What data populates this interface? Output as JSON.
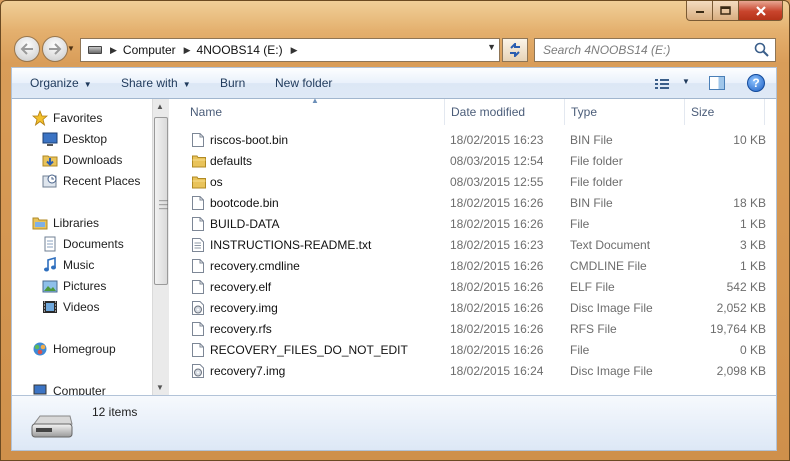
{
  "window": {
    "controls": {
      "minimize_icon": "minimize-icon",
      "maximize_icon": "maximize-icon",
      "close_icon": "close-icon"
    }
  },
  "address": {
    "crumbs": [
      "Computer",
      "4NOOBS14 (E:)"
    ]
  },
  "search": {
    "placeholder": "Search 4NOOBS14 (E:)"
  },
  "toolbar": {
    "organize": "Organize",
    "share_with": "Share with",
    "burn": "Burn",
    "new_folder": "New folder"
  },
  "sidebar": {
    "items": [
      {
        "label": "Favorites",
        "icon": "star-icon"
      },
      {
        "label": "Desktop",
        "icon": "desktop-icon"
      },
      {
        "label": "Downloads",
        "icon": "downloads-icon"
      },
      {
        "label": "Recent Places",
        "icon": "recent-places-icon"
      },
      {
        "label": "Libraries",
        "icon": "libraries-icon"
      },
      {
        "label": "Documents",
        "icon": "documents-icon"
      },
      {
        "label": "Music",
        "icon": "music-icon"
      },
      {
        "label": "Pictures",
        "icon": "pictures-icon"
      },
      {
        "label": "Videos",
        "icon": "videos-icon"
      },
      {
        "label": "Homegroup",
        "icon": "homegroup-icon"
      },
      {
        "label": "Computer",
        "icon": "computer-icon"
      }
    ]
  },
  "columns": {
    "name": "Name",
    "date": "Date modified",
    "type": "Type",
    "size": "Size"
  },
  "files": [
    {
      "name": "riscos-boot.bin",
      "date": "18/02/2015 16:23",
      "type": "BIN File",
      "size": "10 KB",
      "icon": "file-icon"
    },
    {
      "name": "defaults",
      "date": "08/03/2015 12:54",
      "type": "File folder",
      "size": "",
      "icon": "folder-icon"
    },
    {
      "name": "os",
      "date": "08/03/2015 12:55",
      "type": "File folder",
      "size": "",
      "icon": "folder-icon"
    },
    {
      "name": "bootcode.bin",
      "date": "18/02/2015 16:26",
      "type": "BIN File",
      "size": "18 KB",
      "icon": "file-icon"
    },
    {
      "name": "BUILD-DATA",
      "date": "18/02/2015 16:26",
      "type": "File",
      "size": "1 KB",
      "icon": "file-icon"
    },
    {
      "name": "INSTRUCTIONS-README.txt",
      "date": "18/02/2015 16:23",
      "type": "Text Document",
      "size": "3 KB",
      "icon": "text-file-icon"
    },
    {
      "name": "recovery.cmdline",
      "date": "18/02/2015 16:26",
      "type": "CMDLINE File",
      "size": "1 KB",
      "icon": "file-icon"
    },
    {
      "name": "recovery.elf",
      "date": "18/02/2015 16:26",
      "type": "ELF File",
      "size": "542 KB",
      "icon": "file-icon"
    },
    {
      "name": "recovery.img",
      "date": "18/02/2015 16:26",
      "type": "Disc Image File",
      "size": "2,052 KB",
      "icon": "disc-image-icon"
    },
    {
      "name": "recovery.rfs",
      "date": "18/02/2015 16:26",
      "type": "RFS File",
      "size": "19,764 KB",
      "icon": "file-icon"
    },
    {
      "name": "RECOVERY_FILES_DO_NOT_EDIT",
      "date": "18/02/2015 16:26",
      "type": "File",
      "size": "0 KB",
      "icon": "file-icon"
    },
    {
      "name": "recovery7.img",
      "date": "18/02/2015 16:24",
      "type": "Disc Image File",
      "size": "2,098 KB",
      "icon": "disc-image-icon"
    }
  ],
  "status": {
    "count": "12 items",
    "icon": "removable-drive-icon"
  }
}
